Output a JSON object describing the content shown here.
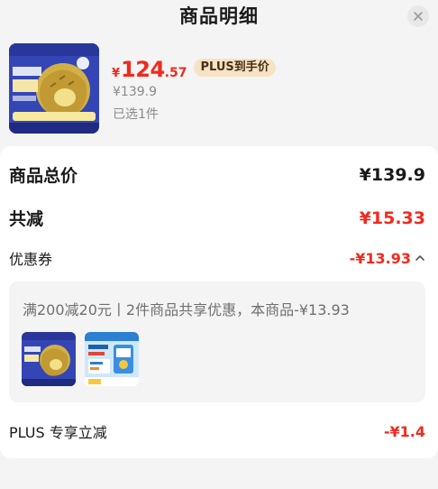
{
  "header": {
    "title": "商品明细"
  },
  "product": {
    "price_currency": "¥",
    "price_integer": "124",
    "price_decimal": ".57",
    "plus_badge": "PLUS到手价",
    "original_price": "¥139.9",
    "selected_count": "已选1件"
  },
  "summary": {
    "total_label": "商品总价",
    "total_value": "¥139.9",
    "reduction_label": "共减",
    "reduction_value": "¥15.33",
    "coupon_label": "优惠券",
    "coupon_value": "-¥13.93",
    "coupon_detail": "满200减20元丨2件商品共享优惠，本商品-¥13.93",
    "plus_label": "PLUS 专享立减",
    "plus_value": "-¥1.4"
  },
  "colors": {
    "accent_red": "#f02a1f",
    "plus_gold": "#f6e3c5"
  }
}
